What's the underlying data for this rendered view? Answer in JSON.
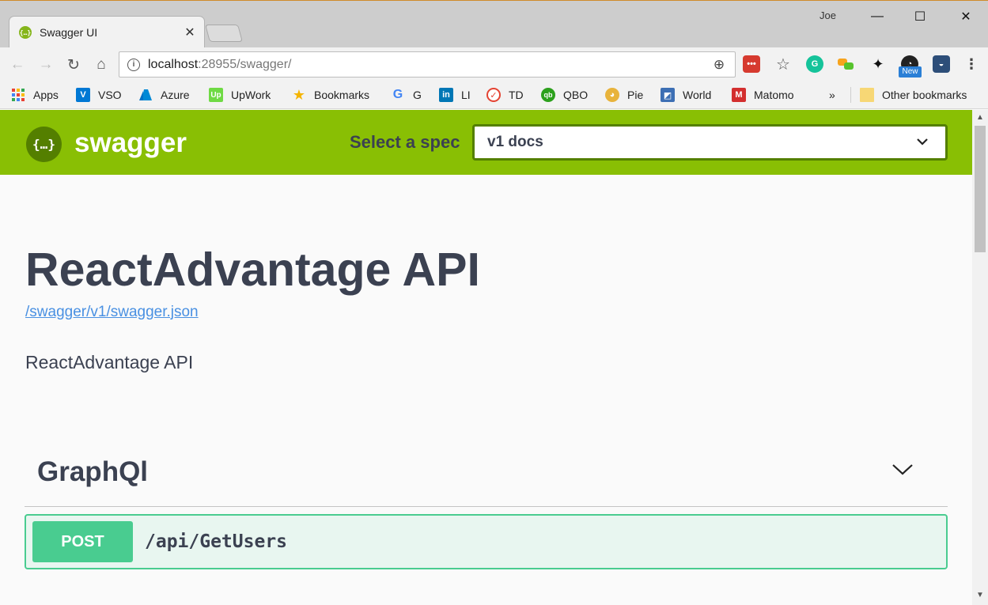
{
  "browser": {
    "tab_title": "Swagger UI",
    "user_name": "Joe",
    "url_host": "localhost",
    "url_rest": ":28955/swagger/",
    "new_badge": "New",
    "bookmarks": [
      {
        "label": "Apps",
        "icon": "apps-grid-icon",
        "color": "#e94235"
      },
      {
        "label": "VSO",
        "icon": "vso-icon",
        "color": "#0078d4"
      },
      {
        "label": "Azure",
        "icon": "azure-icon",
        "color": "#0089d6"
      },
      {
        "label": "UpWork",
        "icon": "upwork-icon",
        "color": "#6fda44"
      },
      {
        "label": "Bookmarks",
        "icon": "star-icon",
        "color": "#f4b400"
      },
      {
        "label": "G",
        "icon": "google-icon",
        "color": "#4285f4"
      },
      {
        "label": "LI",
        "icon": "linkedin-icon",
        "color": "#0077b5"
      },
      {
        "label": "TD",
        "icon": "todoist-icon",
        "color": "#e44332"
      },
      {
        "label": "QBO",
        "icon": "quickbooks-icon",
        "color": "#2ca01c"
      },
      {
        "label": "Pie",
        "icon": "pie-icon",
        "color": "#e8b33b"
      },
      {
        "label": "World",
        "icon": "world-icon",
        "color": "#3d6fb4"
      },
      {
        "label": "Matomo",
        "icon": "matomo-icon",
        "color": "#d32f2f"
      }
    ],
    "more_bookmarks": "»",
    "other_bookmarks": "Other bookmarks"
  },
  "swagger": {
    "brand": "swagger",
    "select_spec_label": "Select a spec",
    "selected_spec": "v1 docs",
    "api_title": "ReactAdvantage API",
    "spec_url": "/swagger/v1/swagger.json",
    "description": "ReactAdvantage API",
    "tags": [
      {
        "name": "GraphQl",
        "operations": [
          {
            "method": "POST",
            "path": "/api/GetUsers"
          }
        ]
      }
    ]
  },
  "colors": {
    "topbar": "#89bf04",
    "post": "#49cc90",
    "link": "#4990e2",
    "text": "#3b4151"
  }
}
